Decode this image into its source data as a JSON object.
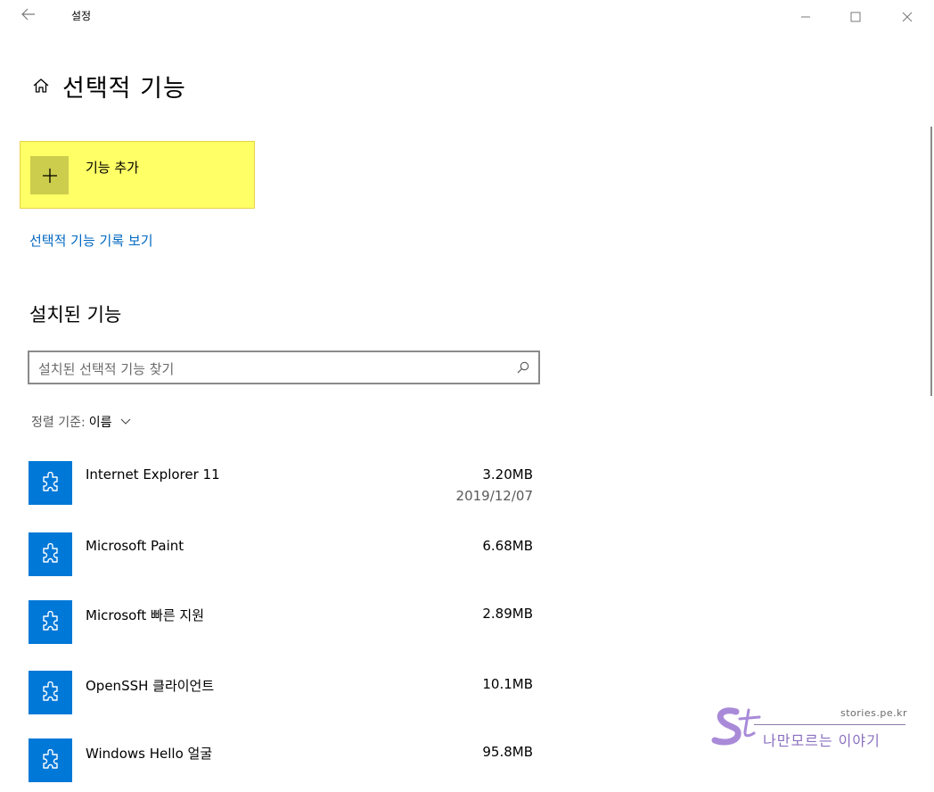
{
  "window": {
    "title": "설정",
    "back_icon": "back-arrow-icon",
    "controls": [
      "minimize-icon",
      "maximize-icon",
      "close-icon"
    ]
  },
  "header": {
    "home_icon": "home-icon",
    "title": "선택적 기능"
  },
  "add_feature": {
    "label": "기능 추가",
    "icon": "plus-icon",
    "highlight_color": "#ffff66"
  },
  "history_link": {
    "label": "선택적 기능 기록 보기",
    "color": "#0067c0"
  },
  "installed": {
    "title": "설치된 기능",
    "search": {
      "placeholder": "설치된 선택적 기능 찾기",
      "icon": "search-icon"
    },
    "sort": {
      "label": "정렬 기준:",
      "value": "이름",
      "icon": "chevron-down-icon"
    },
    "items": [
      {
        "name": "Internet Explorer 11",
        "size": "3.20MB",
        "date": "2019/12/07",
        "icon": "puzzle-icon"
      },
      {
        "name": "Microsoft Paint",
        "size": "6.68MB",
        "date": "",
        "icon": "puzzle-icon"
      },
      {
        "name": "Microsoft 빠른 지원",
        "size": "2.89MB",
        "date": "",
        "icon": "puzzle-icon"
      },
      {
        "name": "OpenSSH 클라이언트",
        "size": "10.1MB",
        "date": "",
        "icon": "puzzle-icon"
      },
      {
        "name": "Windows Hello 얼굴",
        "size": "95.8MB",
        "date": "",
        "icon": "puzzle-icon"
      }
    ]
  },
  "watermark": {
    "domain": "stories.pe.kr",
    "text": "나만모르는 이야기",
    "logo": "St"
  },
  "colors": {
    "accent": "#0078d7",
    "link": "#0067c0",
    "highlight": "#ffff66"
  }
}
